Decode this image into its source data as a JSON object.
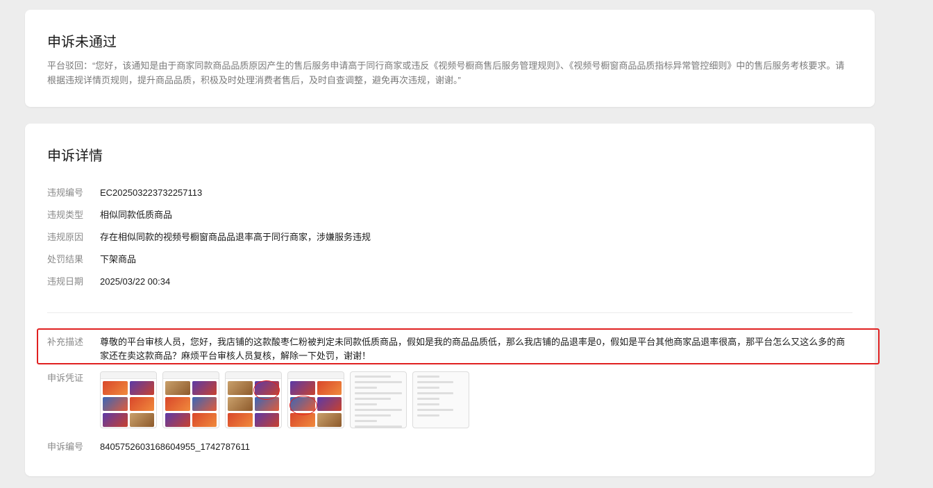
{
  "reject_card": {
    "title": "申诉未通过",
    "text": "平台驳回：“您好，该通知是由于商家同款商品品质原因产生的售后服务申请高于同行商家或违反《视频号橱商售后服务管理规则》、《视频号橱窗商品品质指标异常管控细则》中的售后服务考核要求。请根据违规详情页规则，提升商品品质，积极及时处理消费者售后，及时自查调整，避免再次违规，谢谢。”"
  },
  "detail_card": {
    "title": "申诉详情",
    "rows": [
      {
        "label": "违规编号",
        "value": "EC202503223732257113"
      },
      {
        "label": "违规类型",
        "value": "相似同款低质商品"
      },
      {
        "label": "违规原因",
        "value": "存在相似同款的视频号橱窗商品品退率高于同行商家，涉嫌服务违规"
      },
      {
        "label": "处罚结果",
        "value": "下架商品"
      },
      {
        "label": "违规日期",
        "value": "2025/03/22 00:34"
      }
    ],
    "supplement": {
      "label": "补充描述",
      "value": "尊敬的平台审核人员，您好，我店铺的这款酸枣仁粉被判定未同款低质商品，假如是我的商品品质低，那么我店铺的品退率是0，假如是平台其他商家品退率很高，那平台怎么又这么多的商家还在卖这款商品？麻烦平台审核人员复核，解除一下处罚，谢谢！"
    },
    "proof": {
      "label": "申诉凭证",
      "thumbnails": [
        "screenshot-1",
        "screenshot-2",
        "screenshot-3",
        "screenshot-4",
        "screenshot-5",
        "screenshot-6"
      ]
    },
    "appeal_no": {
      "label": "申诉编号",
      "value": "8405752603168604955_1742787611"
    }
  },
  "colors": {
    "highlight": "#e02020",
    "label": "#8a8a8a",
    "muted_text": "#7a7a7a"
  }
}
